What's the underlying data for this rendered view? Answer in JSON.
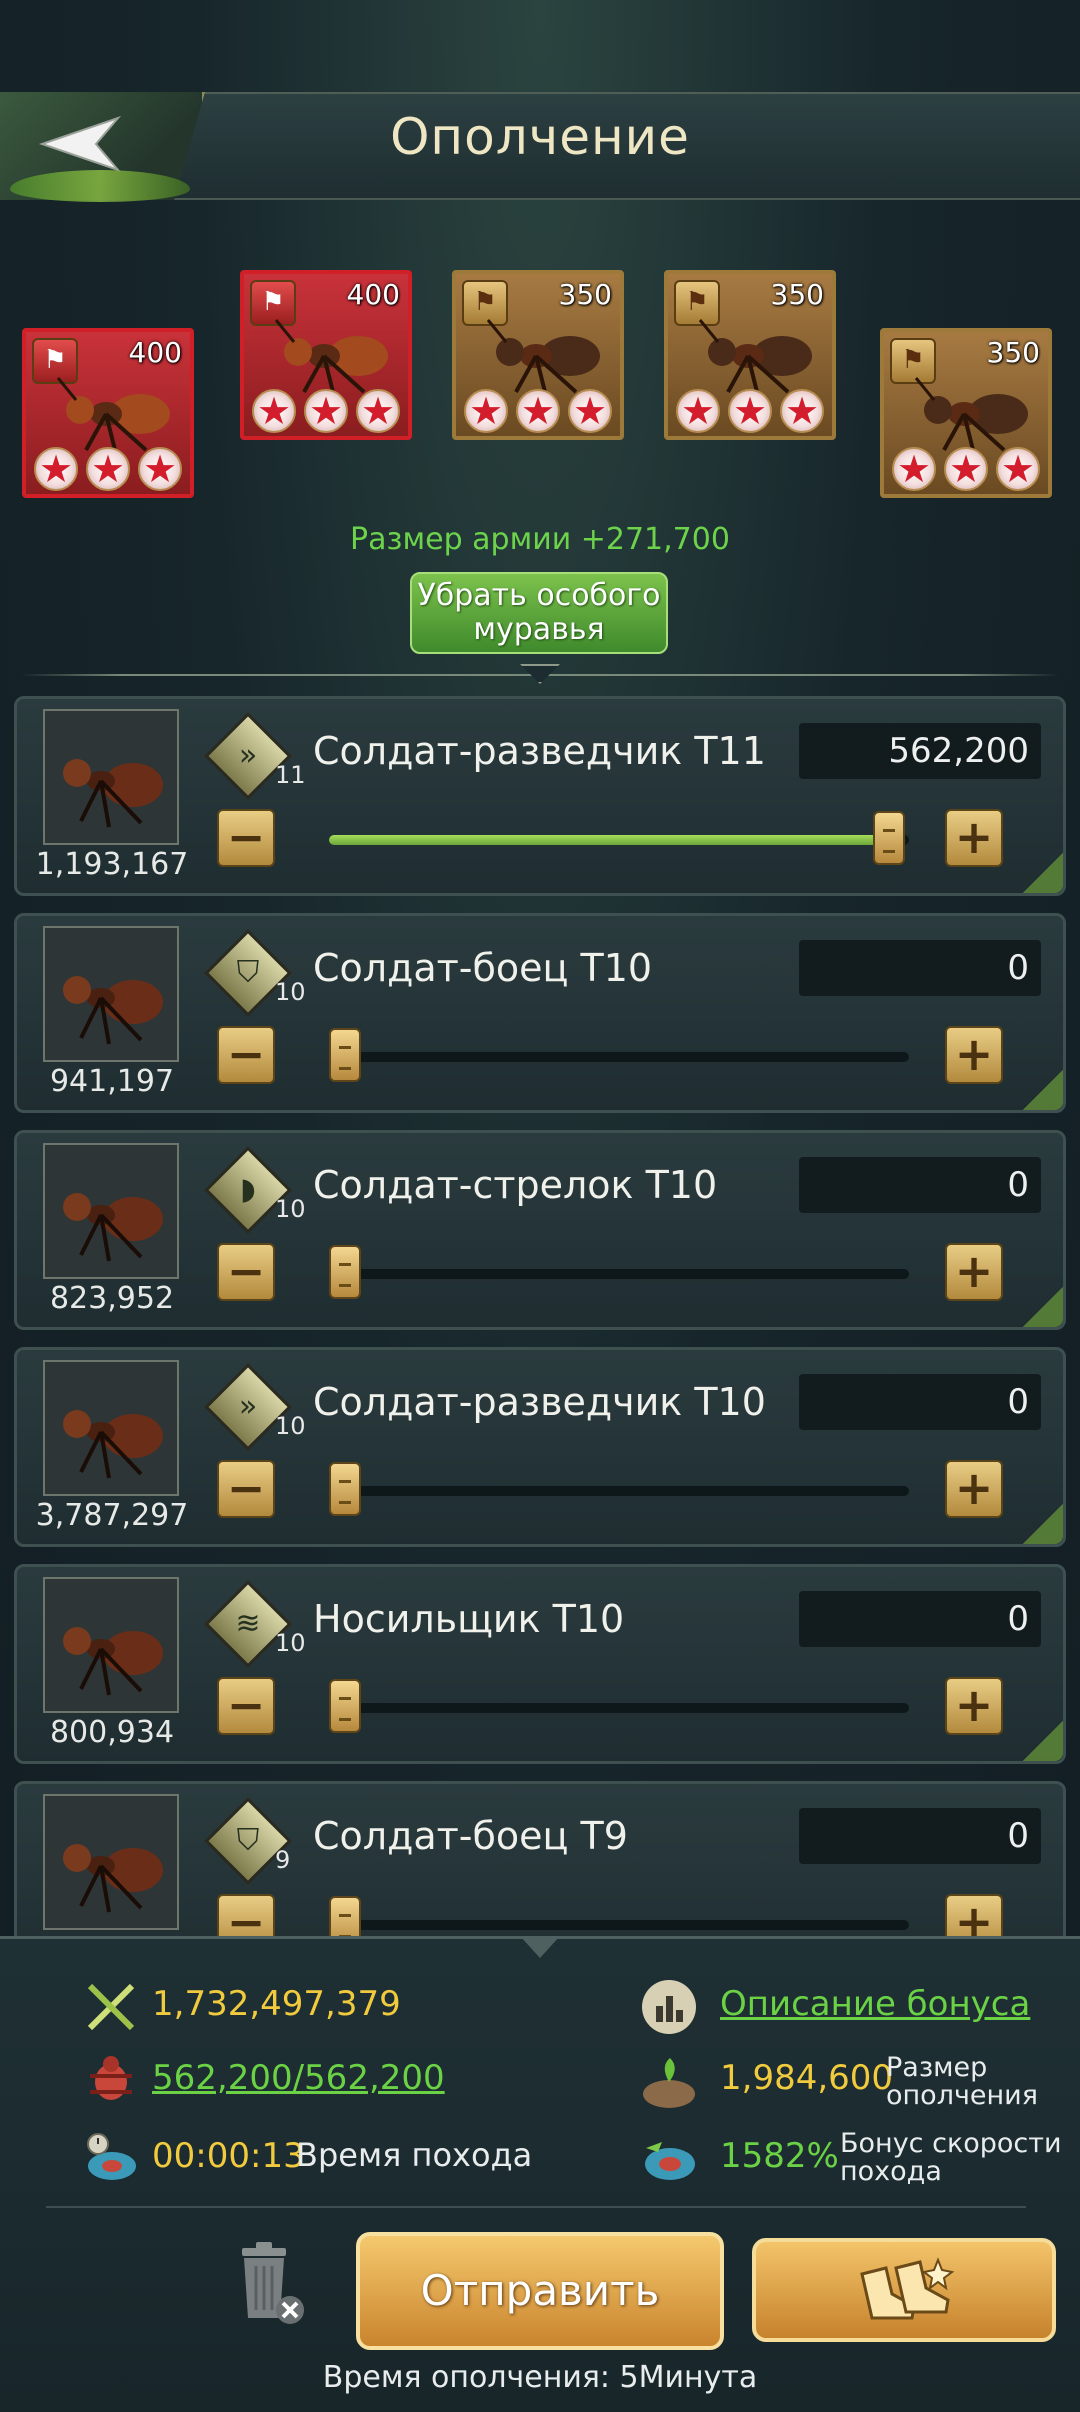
{
  "header": {
    "title": "Ополчение",
    "back_icon": "back-arrow-icon"
  },
  "special_ants": [
    {
      "value": "400",
      "stars": 3,
      "frame": "red"
    },
    {
      "value": "400",
      "stars": 3,
      "frame": "red"
    },
    {
      "value": "350",
      "stars": 3,
      "frame": "brown"
    },
    {
      "value": "350",
      "stars": 3,
      "frame": "brown"
    },
    {
      "value": "350",
      "stars": 3,
      "frame": "brown"
    }
  ],
  "army_size": "Размер армии +271,700",
  "remove_special_button": {
    "line1": "Убрать особого",
    "line2": "муравья"
  },
  "troops": [
    {
      "name": "Солдат-разведчик T11",
      "tier": "11",
      "available": "1,193,167",
      "value": "562,200",
      "fill": 1.0
    },
    {
      "name": "Солдат-боец T10",
      "tier": "10",
      "available": "941,197",
      "value": "0",
      "fill": 0
    },
    {
      "name": "Солдат-стрелок T10",
      "tier": "10",
      "available": "823,952",
      "value": "0",
      "fill": 0
    },
    {
      "name": "Солдат-разведчик T10",
      "tier": "10",
      "available": "3,787,297",
      "value": "0",
      "fill": 0
    },
    {
      "name": "Носильщик T10",
      "tier": "10",
      "available": "800,934",
      "value": "0",
      "fill": 0
    },
    {
      "name": "Солдат-боец T9",
      "tier": "9",
      "available": "",
      "value": "0",
      "fill": 0
    }
  ],
  "stats": {
    "power": "1,732,497,379",
    "bonus_link": "Описание бонуса",
    "troops_count": "562,200/562,200",
    "militia_size_value": "1,984,600",
    "militia_size_label_1": "Размер",
    "militia_size_label_2": "ополчения",
    "march_time_value": "00:00:13",
    "march_time_label": "Время похода",
    "speed_bonus_value": "1582%",
    "speed_bonus_label_1": "Бонус скорости",
    "speed_bonus_label_2": "похода"
  },
  "actions": {
    "send_label": "Отправить"
  },
  "footer": "Время ополчения: 5Минута",
  "colors": {
    "green": "#6bd246",
    "yellow": "#f1cb3d",
    "gold": "#c9842d",
    "red_frame": "#d11f27"
  }
}
